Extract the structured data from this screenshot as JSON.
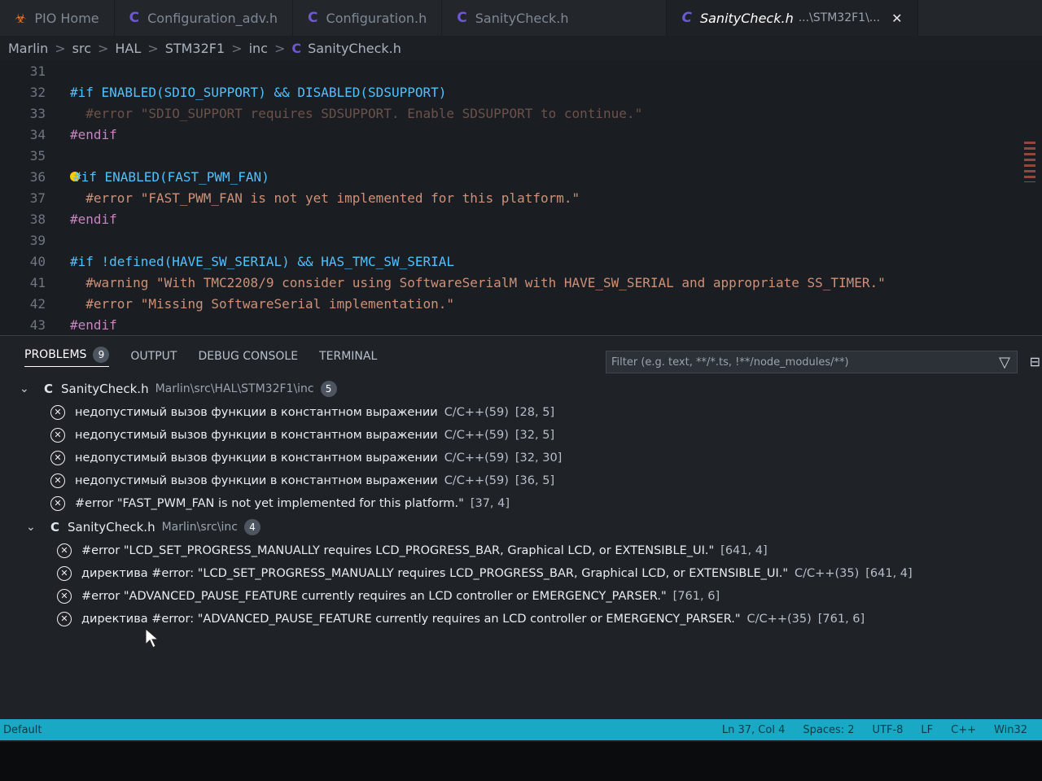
{
  "tabs": [
    {
      "label": "PIO Home",
      "icon": "platformio-icon"
    },
    {
      "label": "Configuration_adv.h",
      "icon": "c-file-icon"
    },
    {
      "label": "Configuration.h",
      "icon": "c-file-icon"
    },
    {
      "label": "SanityCheck.h",
      "icon": "c-file-icon"
    },
    {
      "label": "SanityCheck.h",
      "path": "...\\STM32F1\\...",
      "icon": "c-file-icon",
      "active": true
    }
  ],
  "breadcrumb": [
    "Marlin",
    "src",
    "HAL",
    "STM32F1",
    "inc",
    "SanityCheck.h"
  ],
  "editor": {
    "lines": [
      {
        "n": "31",
        "t": ""
      },
      {
        "n": "32",
        "t": "#if ENABLED(SDIO_SUPPORT) && DISABLED(SDSUPPORT)"
      },
      {
        "n": "33",
        "t": "  #error \"SDIO_SUPPORT requires SDSUPPORT. Enable SDSUPPORT to continue.\""
      },
      {
        "n": "34",
        "t": "#endif"
      },
      {
        "n": "35",
        "t": ""
      },
      {
        "n": "36",
        "t": "#if ENABLED(FAST_PWM_FAN)"
      },
      {
        "n": "37",
        "t": "  #error \"FAST_PWM_FAN is not yet implemented for this platform.\""
      },
      {
        "n": "38",
        "t": "#endif"
      },
      {
        "n": "39",
        "t": ""
      },
      {
        "n": "40",
        "t": "#if !defined(HAVE_SW_SERIAL) && HAS_TMC_SW_SERIAL"
      },
      {
        "n": "41",
        "t": "  #warning \"With TMC2208/9 consider using SoftwareSerialM with HAVE_SW_SERIAL and appropriate SS_TIMER.\""
      },
      {
        "n": "42",
        "t": "  #error \"Missing SoftwareSerial implementation.\""
      },
      {
        "n": "43",
        "t": "#endif"
      }
    ]
  },
  "panel": {
    "tabs": {
      "problems": "PROBLEMS",
      "problems_count": "9",
      "output": "OUTPUT",
      "debug": "DEBUG CONSOLE",
      "terminal": "TERMINAL"
    },
    "filter_placeholder": "Filter (e.g. text, **/*.ts, !**/node_modules/**)",
    "groups": [
      {
        "file": "SanityCheck.h",
        "path": "Marlin\\src\\HAL\\STM32F1\\inc",
        "count": "5",
        "items": [
          {
            "msg": "недопустимый вызов функции в константном выражении",
            "src": "C/C++(59)",
            "pos": "[28, 5]"
          },
          {
            "msg": "недопустимый вызов функции в константном выражении",
            "src": "C/C++(59)",
            "pos": "[32, 5]"
          },
          {
            "msg": "недопустимый вызов функции в константном выражении",
            "src": "C/C++(59)",
            "pos": "[32, 30]"
          },
          {
            "msg": "недопустимый вызов функции в константном выражении",
            "src": "C/C++(59)",
            "pos": "[36, 5]"
          },
          {
            "msg": "#error \"FAST_PWM_FAN is not yet implemented for this platform.\"",
            "src": "",
            "pos": "[37, 4]"
          }
        ]
      },
      {
        "file": "SanityCheck.h",
        "path": "Marlin\\src\\inc",
        "count": "4",
        "items": [
          {
            "msg": "#error \"LCD_SET_PROGRESS_MANUALLY requires LCD_PROGRESS_BAR, Graphical LCD, or EXTENSIBLE_UI.\"",
            "src": "",
            "pos": "[641, 4]"
          },
          {
            "msg": "директива #error: \"LCD_SET_PROGRESS_MANUALLY requires LCD_PROGRESS_BAR, Graphical LCD, or EXTENSIBLE_UI.\"",
            "src": "C/C++(35)",
            "pos": "[641, 4]"
          },
          {
            "msg": "#error \"ADVANCED_PAUSE_FEATURE currently requires an LCD controller or EMERGENCY_PARSER.\"",
            "src": "",
            "pos": "[761, 6]"
          },
          {
            "msg": "директива #error: \"ADVANCED_PAUSE_FEATURE currently requires an LCD controller or EMERGENCY_PARSER.\"",
            "src": "C/C++(35)",
            "pos": "[761, 6]"
          }
        ]
      }
    ]
  },
  "status": {
    "left": "Default",
    "position": "Ln 37, Col 4",
    "spaces": "Spaces: 2",
    "encoding": "UTF-8",
    "eol": "LF",
    "lang": "C++",
    "platform": "Win32"
  },
  "colors": {
    "accent": "#1aa9c5",
    "macro": "#4fc1ff",
    "keyword": "#c586c0",
    "string": "#ce9178"
  }
}
